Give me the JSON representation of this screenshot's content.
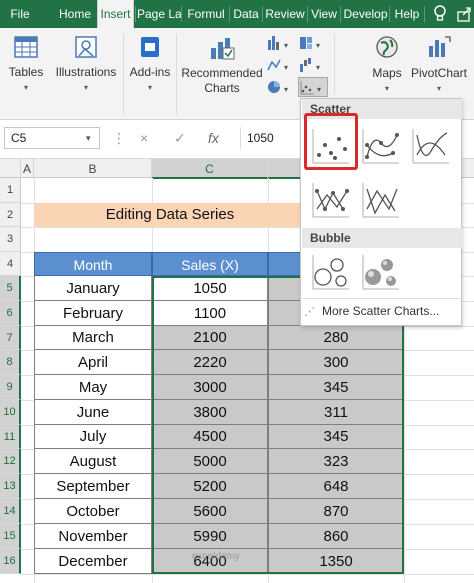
{
  "ribbon_tabs": [
    "File",
    "Home",
    "Insert",
    "Page La",
    "Formul",
    "Data",
    "Review",
    "View",
    "Develop",
    "Help"
  ],
  "ribbon": {
    "tables_label": "Tables",
    "illustrations_label": "Illustrations",
    "addins_label": "Add-ins",
    "recommended_label": "Recommended Charts",
    "maps_label": "Maps",
    "pivotchart_label": "PivotChart"
  },
  "formula_bar": {
    "name_box": "C5",
    "cancel": "×",
    "enter": "✓",
    "fx": "fx",
    "value": "1050"
  },
  "columns": [
    "A",
    "B",
    "C"
  ],
  "rows": [
    "1",
    "2",
    "3",
    "4",
    "5",
    "6",
    "7",
    "8",
    "9",
    "10",
    "11",
    "12",
    "13",
    "14",
    "15",
    "16"
  ],
  "title": "Editing Data Series",
  "table": {
    "headers": [
      "Month",
      "Sales (X)"
    ],
    "months": [
      "January",
      "February",
      "March",
      "April",
      "May",
      "June",
      "July",
      "August",
      "September",
      "October",
      "November",
      "December"
    ],
    "sales": [
      "1050",
      "1100",
      "2100",
      "2220",
      "3000",
      "3800",
      "4500",
      "5000",
      "5200",
      "5600",
      "5990",
      "6400"
    ],
    "third_col": [
      "",
      "",
      "280",
      "300",
      "345",
      "311",
      "345",
      "323",
      "648",
      "870",
      "860",
      "1350"
    ]
  },
  "dropdown": {
    "scatter_label": "Scatter",
    "bubble_label": "Bubble",
    "more_label": "More Scatter Charts..."
  },
  "watermark": "exceldemy"
}
